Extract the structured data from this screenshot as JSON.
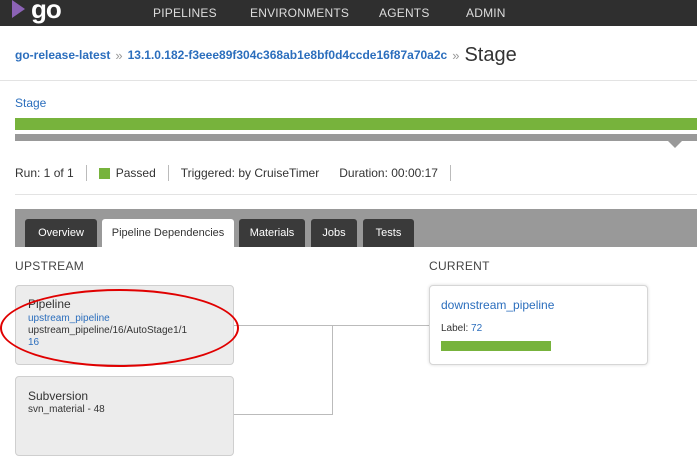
{
  "header": {
    "logo_text": "go",
    "nav": [
      "PIPELINES",
      "ENVIRONMENTS",
      "AGENTS",
      "ADMIN"
    ]
  },
  "breadcrumb": {
    "pipeline": "go-release-latest",
    "sep": "»",
    "run": "13.1.0.182-f3eee89f304c368ab1e8bf0d4ccde16f87a70a2c",
    "title": "Stage"
  },
  "stage_link": "Stage",
  "run_info": {
    "run": "Run: 1 of 1",
    "status": "Passed",
    "triggered": "Triggered: by CruiseTimer",
    "duration": "Duration: 00:00:17"
  },
  "tabs": [
    "Overview",
    "Pipeline Dependencies",
    "Materials",
    "Jobs",
    "Tests"
  ],
  "upstream": {
    "heading": "UPSTREAM",
    "pipeline_card": {
      "type": "Pipeline",
      "name": "upstream_pipeline",
      "path": "upstream_pipeline/16/AutoStage1/1",
      "counter": "16"
    },
    "svn_card": {
      "type": "Subversion",
      "detail": "svn_material - 48"
    }
  },
  "current": {
    "heading": "CURRENT",
    "pipeline": "downstream_pipeline",
    "label_text": "Label:",
    "label_value": "72"
  },
  "colors": {
    "passed": "#77b33c",
    "link": "#2b6ebd",
    "highlight": "#e00000"
  }
}
